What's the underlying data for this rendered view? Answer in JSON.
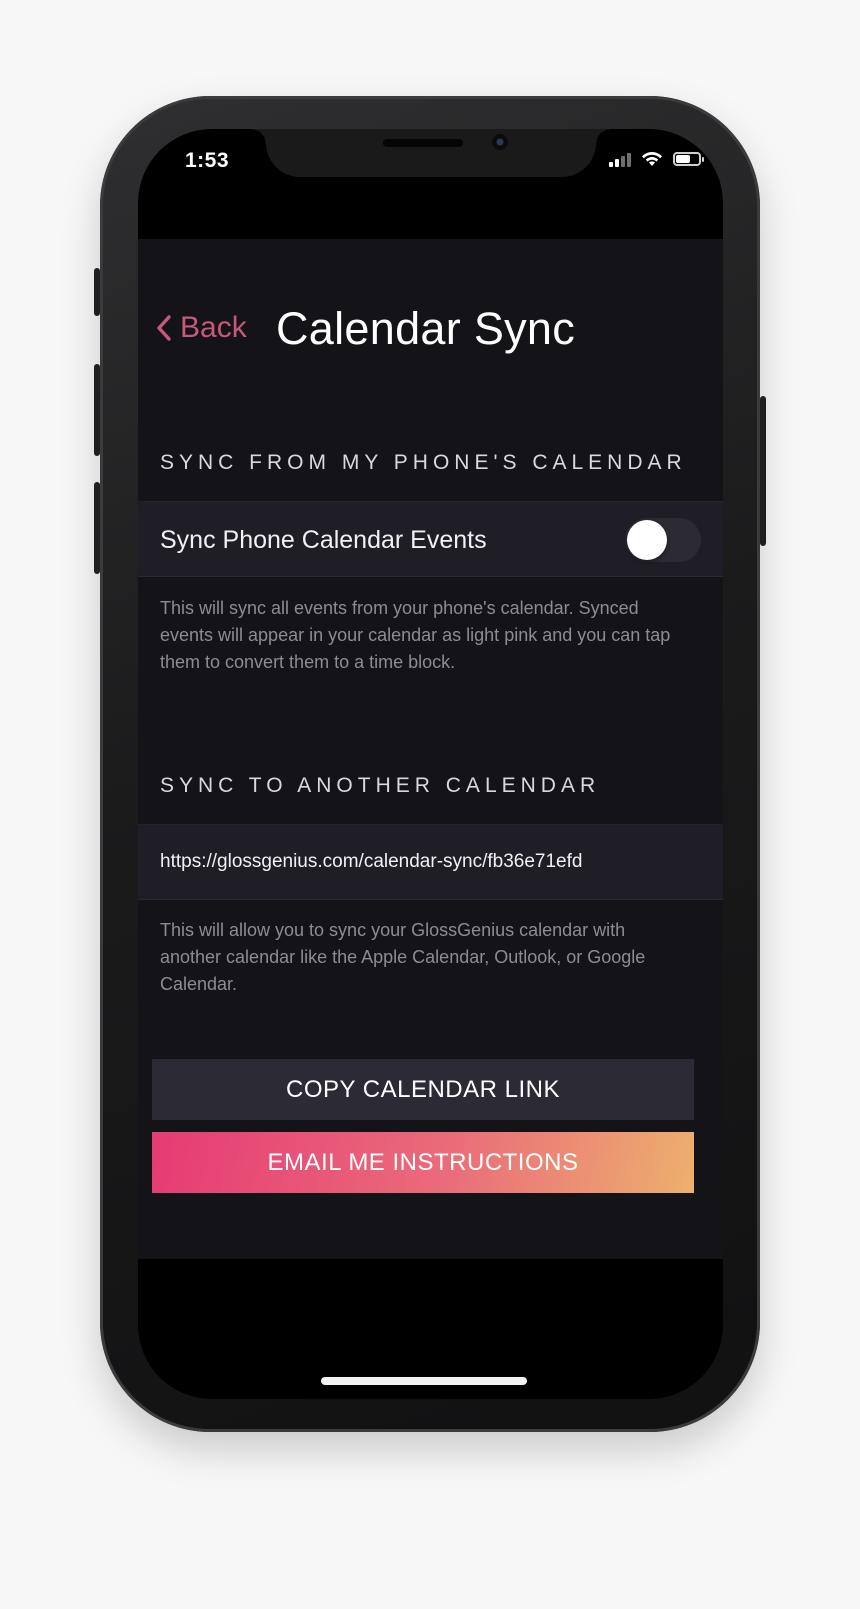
{
  "status_bar": {
    "time": "1:53",
    "icons": [
      "cellular-signal-icon",
      "wifi-icon",
      "battery-icon"
    ]
  },
  "nav": {
    "back_label": "Back",
    "back_icon": "chevron-left-icon",
    "title": "Calendar Sync"
  },
  "phone_calendar_section": {
    "header": "SYNC FROM MY PHONE'S CALENDAR",
    "row_label": "Sync Phone Calendar Events",
    "toggle_on": false,
    "description": "This will sync all events from your phone's calendar. Synced events will appear in your calendar as light pink and you can tap them to convert them to a time block."
  },
  "another_calendar_section": {
    "header": "SYNC TO ANOTHER CALENDAR",
    "link": "https://glossgenius.com/calendar-sync/fb36e71efd",
    "description": "This will allow you to sync your GlossGenius calendar with another calendar like the Apple Calendar, Outlook, or Google Calendar."
  },
  "actions": {
    "copy_label": "COPY CALENDAR LINK",
    "email_label": "EMAIL ME INSTRUCTIONS"
  },
  "colors": {
    "accent": "#c6587a",
    "background": "#141317",
    "row_background": "#1f1e26",
    "gradient_start": "#e63b74",
    "gradient_end": "#edb06e"
  }
}
